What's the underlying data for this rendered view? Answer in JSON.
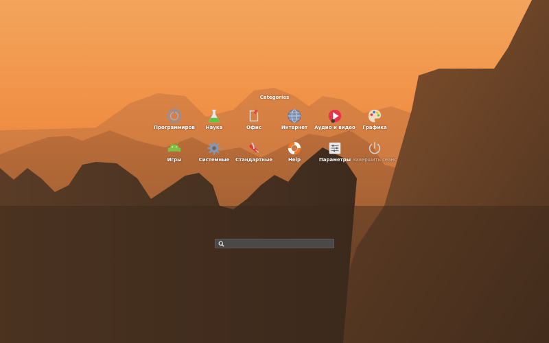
{
  "launcher": {
    "title": "Categories",
    "categories": [
      {
        "label": "Программиров",
        "icon": "development-icon"
      },
      {
        "label": "Наука",
        "icon": "science-flask-icon"
      },
      {
        "label": "Офис",
        "icon": "office-icon"
      },
      {
        "label": "Интернет",
        "icon": "globe-icon"
      },
      {
        "label": "Аудио и видео",
        "icon": "multimedia-icon"
      },
      {
        "label": "Графика",
        "icon": "palette-icon"
      },
      {
        "label": "Игры",
        "icon": "android-game-icon"
      },
      {
        "label": "Системные",
        "icon": "gear-icon"
      },
      {
        "label": "Стандартные",
        "icon": "swiss-knife-icon"
      },
      {
        "label": "Help",
        "icon": "lifebuoy-icon"
      },
      {
        "label": "Параметры",
        "icon": "settings-sliders-icon"
      },
      {
        "label": "Завершить сеанс",
        "icon": "power-icon"
      }
    ]
  },
  "search": {
    "value": "",
    "icon": "search-icon"
  }
}
